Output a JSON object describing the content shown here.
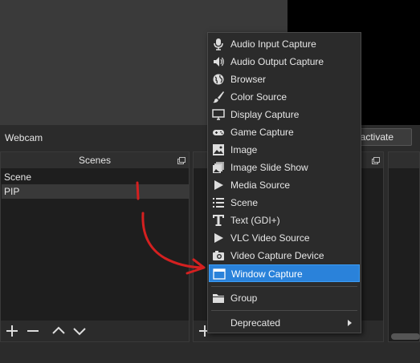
{
  "source_toolbar": {
    "source_name": "Webcam",
    "deactivate_label": "eactivate"
  },
  "scenes_dock": {
    "title": "Scenes",
    "items": [
      {
        "label": "Scene",
        "selected": false
      },
      {
        "label": "PIP",
        "selected": true
      }
    ],
    "footer_icons": [
      "plus-icon",
      "minus-icon",
      "chevron-up-icon",
      "chevron-down-icon"
    ]
  },
  "sources_dock": {
    "footer_icons": [
      "plus-icon",
      "gear-icon"
    ]
  },
  "context_menu": {
    "items": [
      {
        "label": "Audio Input Capture",
        "icon": "microphone-icon"
      },
      {
        "label": "Audio Output Capture",
        "icon": "speaker-icon"
      },
      {
        "label": "Browser",
        "icon": "globe-icon"
      },
      {
        "label": "Color Source",
        "icon": "paintbrush-icon"
      },
      {
        "label": "Display Capture",
        "icon": "monitor-icon"
      },
      {
        "label": "Game Capture",
        "icon": "gamepad-icon"
      },
      {
        "label": "Image",
        "icon": "image-icon"
      },
      {
        "label": "Image Slide Show",
        "icon": "slideshow-icon"
      },
      {
        "label": "Media Source",
        "icon": "play-icon"
      },
      {
        "label": "Scene",
        "icon": "list-icon"
      },
      {
        "label": "Text (GDI+)",
        "icon": "text-icon"
      },
      {
        "label": "VLC Video Source",
        "icon": "play-icon"
      },
      {
        "label": "Video Capture Device",
        "icon": "camera-icon"
      },
      {
        "label": "Window Capture",
        "icon": "window-icon",
        "highlighted": true
      }
    ],
    "group_label": "Group",
    "deprecated_label": "Deprecated"
  },
  "colors": {
    "accent": "#2a82da",
    "annotation": "#d42020"
  }
}
